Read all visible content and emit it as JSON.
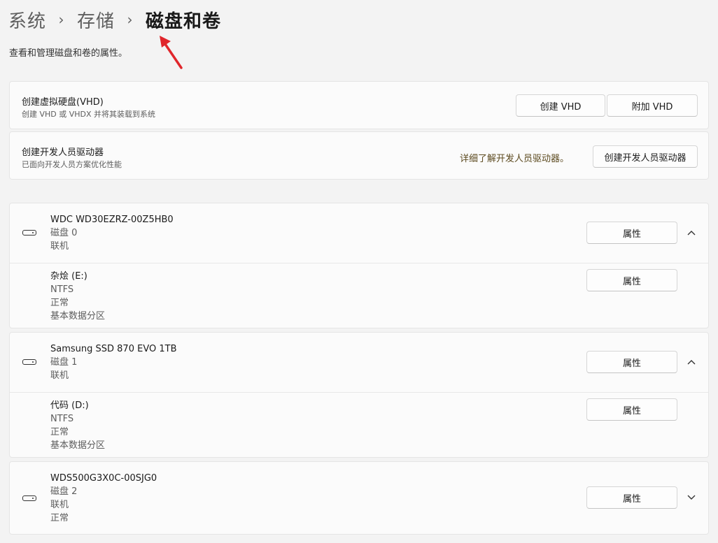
{
  "breadcrumb": {
    "items": [
      "系统",
      "存储",
      "磁盘和卷"
    ],
    "separator": "›"
  },
  "subtitle": "查看和管理磁盘和卷的属性。",
  "vhd": {
    "title": "创建虚拟硬盘(VHD)",
    "subtitle": "创建 VHD 或 VHDX 并将其装载到系统",
    "create_label": "创建 VHD",
    "attach_label": "附加 VHD"
  },
  "devdrive": {
    "title": "创建开发人员驱动器",
    "subtitle": "已面向开发人员方案优化性能",
    "learn_more": "详细了解开发人员驱动器。",
    "create_label": "创建开发人员驱动器"
  },
  "disks": [
    {
      "model": "WDC WD30EZRZ-00Z5HB0",
      "disk": "磁盘 0",
      "status": "联机",
      "expanded": true,
      "volume": {
        "name": "杂烩 (E:)",
        "fs": "NTFS",
        "health": "正常",
        "type": "基本数据分区"
      }
    },
    {
      "model": "Samsung SSD 870 EVO 1TB",
      "disk": "磁盘 1",
      "status": "联机",
      "expanded": true,
      "volume": {
        "name": "代码 (D:)",
        "fs": "NTFS",
        "health": "正常",
        "type": "基本数据分区"
      }
    },
    {
      "model": "WDS500G3X0C-00SJG0",
      "disk": "磁盘 2",
      "status": "联机",
      "health": "正常",
      "expanded": false
    }
  ],
  "properties_label": "属性",
  "icons": {
    "disk": "hard-drive-icon",
    "chevron_up": "chevron-up-icon",
    "chevron_down": "chevron-down-icon",
    "annotation": "red-arrow"
  },
  "colors": {
    "arrow": "#e0262b",
    "link": "#5c4a1f"
  }
}
